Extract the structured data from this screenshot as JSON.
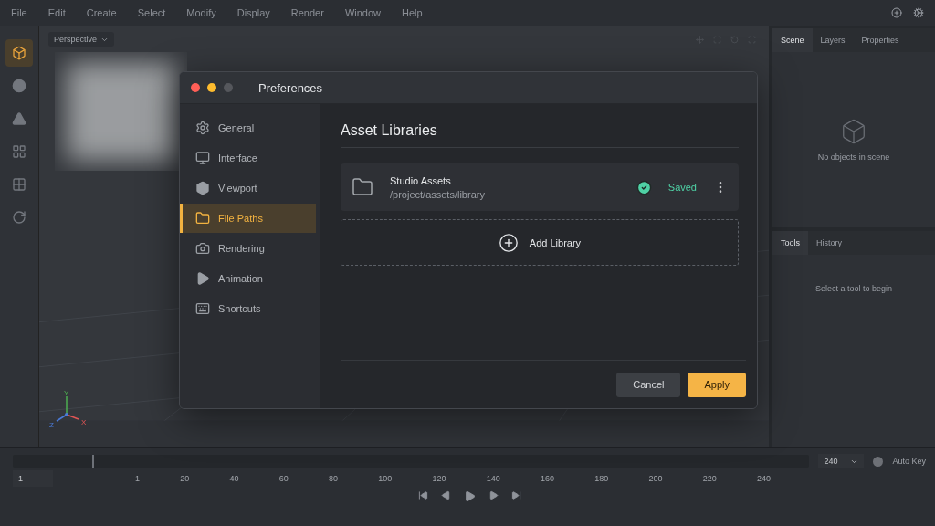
{
  "menu_bar": {
    "items": [
      "File",
      "Edit",
      "Create",
      "Select",
      "Modify",
      "Display",
      "Render",
      "Window",
      "Help"
    ]
  },
  "tool_strip": {
    "tools": [
      {
        "selected": true
      },
      {
        "selected": false
      },
      {
        "selected": false
      },
      {
        "selected": false
      },
      {
        "selected": false
      },
      {
        "selected": false
      }
    ]
  },
  "viewport": {
    "view_menu": "Perspective",
    "axes": [
      "Y",
      "Z",
      "X"
    ]
  },
  "scene_panel": {
    "tabs": [
      {
        "label": "Scene",
        "selected": true
      },
      {
        "label": "Layers",
        "selected": false
      },
      {
        "label": "Properties",
        "selected": false
      }
    ],
    "empty_text": "No objects in scene"
  },
  "tools_panel": {
    "tabs": [
      {
        "label": "Tools",
        "selected": true
      },
      {
        "label": "History",
        "selected": false
      }
    ],
    "empty_text": "Select a tool to begin"
  },
  "timeline": {
    "scrubber": {
      "level": 0.1
    },
    "ruler": [
      "1",
      "20",
      "40",
      "60",
      "80",
      "100",
      "120",
      "140",
      "160",
      "180",
      "200",
      "220",
      "240"
    ],
    "current_frame": "1",
    "end_frame": "240",
    "auto_key": {
      "label": "Auto Key",
      "on": false
    }
  },
  "dialog": {
    "title": "Preferences",
    "window_controls": [
      {
        "color": "#ff5f57"
      },
      {
        "color": "#febc2e"
      },
      {
        "color": "#55575c"
      }
    ],
    "nav": [
      {
        "label": "General",
        "selected": false
      },
      {
        "label": "Interface",
        "selected": false
      },
      {
        "label": "Viewport",
        "selected": false
      },
      {
        "label": "File Paths",
        "selected": true
      },
      {
        "label": "Rendering",
        "selected": false
      },
      {
        "label": "Animation",
        "selected": false
      },
      {
        "label": "Shortcuts",
        "selected": false
      }
    ],
    "heading": "Asset Libraries",
    "libraries": [
      {
        "name": "Studio Assets",
        "path": "/project/assets/library",
        "status": "Saved"
      }
    ],
    "add_button": "Add Library",
    "cancel": "Cancel",
    "apply": "Apply"
  }
}
